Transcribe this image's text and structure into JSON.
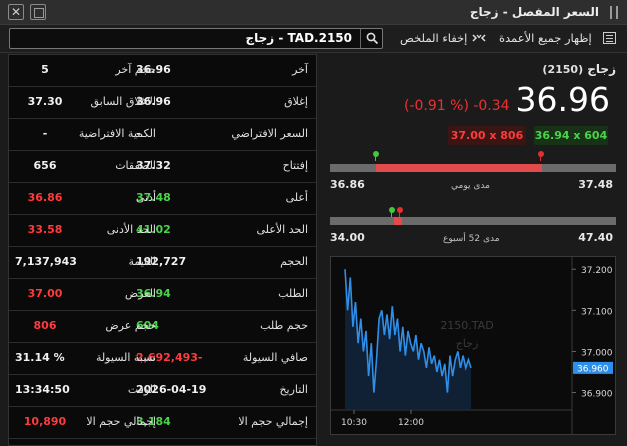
{
  "window": {
    "title": "السعر المفصل - زجاج",
    "close_glyph": "✕"
  },
  "toolbar": {
    "search_value": "TAD.2150 - زجاج",
    "hide_summary_label": "إخفاء الملخص",
    "show_all_columns_label": "إظهار جميع الأعمدة"
  },
  "table": {
    "rows": [
      {
        "label": "آخر",
        "value": "36.96",
        "label2": "حجم آخر",
        "value2": "5"
      },
      {
        "label": "إغلاق",
        "value": "36.96",
        "label2": "الاغلاق السابق",
        "value2": "37.30"
      },
      {
        "label": "السعر الافتراضي",
        "value": "-",
        "label2": "الكمية الافتراضية",
        "value2": "-"
      },
      {
        "label": "إفتتاح",
        "value": "37.32",
        "label2": "الصفقات",
        "value2": "656"
      },
      {
        "label": "أعلى",
        "value": "37.48",
        "label2": "أدنى",
        "value2": "36.86"
      },
      {
        "label": "الحد الأعلى",
        "value": "41.02",
        "label2": "الحد الأدنى",
        "value2": "33.58"
      },
      {
        "label": "الحجم",
        "value": "192,727",
        "label2": "القيمة",
        "value2": "7,137,943"
      },
      {
        "label": "الطلب",
        "value": "36.94",
        "label2": "العرض",
        "value2": "37.00"
      },
      {
        "label": "حجم طلب",
        "value": "604",
        "label2": "حجم عرض",
        "value2": "806"
      },
      {
        "label": "صافي السيولة",
        "value": "2,692,493-",
        "label2": "نسبة السيولة",
        "value2": "31.14 %"
      },
      {
        "label": "التاريخ",
        "value": "2026-04-19",
        "label2": "الوقت",
        "value2": "13:34:50"
      },
      {
        "label": "إجمالي حجم الا",
        "value": "3,184",
        "label2": "إجمالي حجم الا",
        "value2": "10,890"
      }
    ],
    "colors": {
      "value_green": "#4bd44b",
      "value_red": "#ff3b3b",
      "default": "#f0f0f0"
    }
  },
  "summary": {
    "name": "زجاج",
    "code": "(2150)",
    "price": "36.96",
    "change": "(-0.91 %) -0.34",
    "bid_chip": "36.94 x 604",
    "ask_chip": "37.00 x 806"
  },
  "daily_range": {
    "label": "مدى يومي",
    "low": "36.86",
    "high": "37.48"
  },
  "week52_range": {
    "label": "مدى 52 أسبوع",
    "low": "34.00",
    "high": "47.40"
  },
  "chart_data": {
    "type": "line",
    "watermark_line1": "2150.TAD",
    "watermark_line2": "زجاج",
    "x_tick_labels": [
      "10:30",
      "12:00"
    ],
    "y_tick_labels": [
      "37.200",
      "37.100",
      "37.000",
      "36.900"
    ],
    "ylim": [
      36.86,
      37.22
    ],
    "last_value_label": "36.960",
    "line_color": "#2f8fe8",
    "series": [
      {
        "values": [
          37.2,
          37.1,
          37.18,
          37.06,
          37.12,
          37.02,
          37.08,
          37.0,
          37.05,
          36.94,
          37.02,
          36.9,
          36.98,
          37.08,
          37.1,
          37.04,
          37.09,
          37.03,
          37.11,
          37.04,
          37.08,
          37.0,
          37.06,
          36.99,
          37.05,
          37.02,
          37.0,
          37.04,
          36.98,
          37.02,
          37.0,
          36.96,
          37.01,
          36.97,
          36.99,
          36.95,
          36.98,
          36.94,
          36.97,
          36.9,
          36.99,
          36.94,
          36.98,
          37.0,
          36.96,
          36.99,
          36.96,
          36.98,
          36.96
        ]
      }
    ]
  }
}
